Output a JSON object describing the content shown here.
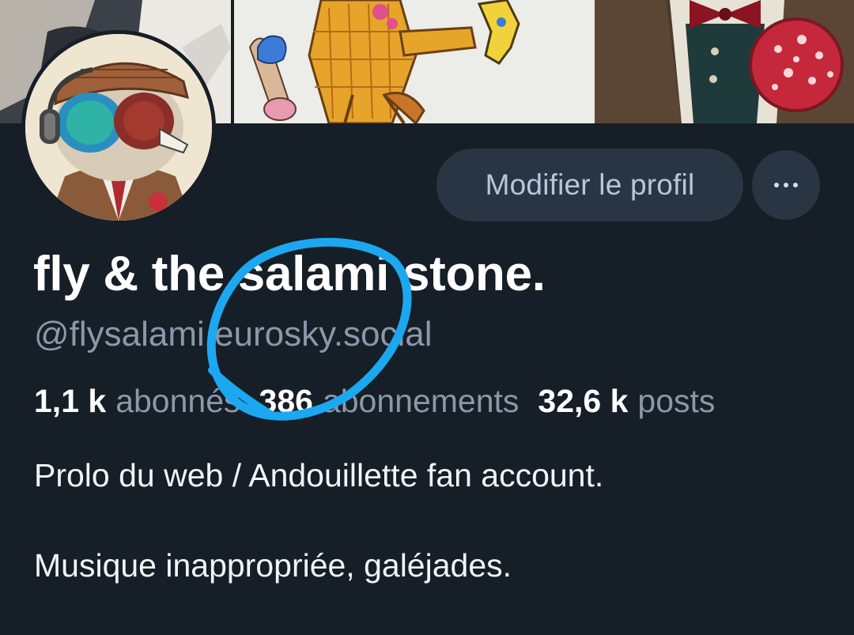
{
  "profile": {
    "display_name": "fly & the salami stone.",
    "handle": "@flysalami.eurosky.social",
    "edit_button_label": "Modifier le profil",
    "more_icon": "ellipsis-icon",
    "stats": {
      "followers_count": "1,1 k",
      "followers_label": "abonnés",
      "following_count": "386",
      "following_label": "abonnements",
      "posts_count": "32,6 k",
      "posts_label": "posts"
    },
    "bio": [
      "Prolo du web / Andouillette fan account.",
      "Musique inappropriée, galéjades."
    ]
  },
  "colors": {
    "background": "#161e27",
    "button_bg": "#2a3543",
    "muted_text": "#8a98aa",
    "annotation_blue": "#1ba8f0"
  }
}
